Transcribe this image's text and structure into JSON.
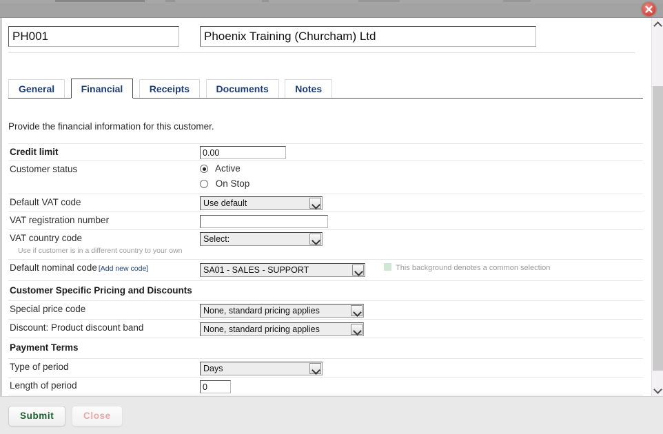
{
  "window": {
    "close_icon": "close-circle-icon"
  },
  "header": {
    "customer_code": "PH001",
    "customer_name": "Phoenix Training (Churcham) Ltd"
  },
  "tabs": [
    {
      "label": "General",
      "active": false
    },
    {
      "label": "Financial",
      "active": true
    },
    {
      "label": "Receipts",
      "active": false
    },
    {
      "label": "Documents",
      "active": false
    },
    {
      "label": "Notes",
      "active": false
    }
  ],
  "intro": "Provide the financial information for this customer.",
  "form": {
    "credit_limit": {
      "label": "Credit limit",
      "value": "0.00"
    },
    "customer_status": {
      "label": "Customer status",
      "options": [
        {
          "label": "Active",
          "checked": true
        },
        {
          "label": "On Stop",
          "checked": false
        }
      ]
    },
    "default_vat_code": {
      "label": "Default VAT code",
      "value": "Use default"
    },
    "vat_registration_number": {
      "label": "VAT registration number",
      "value": ""
    },
    "vat_country_code": {
      "label": "VAT country code",
      "value": "Select:",
      "hint": "Use if customer is in a different country to your own"
    },
    "default_nominal_code": {
      "label": "Default nominal code",
      "add_link": "[Add new code]",
      "value": "SA01 - SALES - SUPPORT"
    },
    "common_selection_legend": "This background denotes a common selection",
    "pricing_section": {
      "title": "Customer Specific Pricing and Discounts",
      "special_price_code": {
        "label": "Special price code",
        "value": "None, standard pricing applies"
      },
      "product_discount_band": {
        "label": "Discount: Product discount band",
        "value": "None, standard pricing applies"
      }
    },
    "payment_section": {
      "title": "Payment Terms",
      "type_of_period": {
        "label": "Type of period",
        "value": "Days"
      },
      "length_of_period": {
        "label": "Length of period",
        "value": "0"
      }
    }
  },
  "footer": {
    "submit_label": "Submit",
    "close_label": "Close"
  },
  "colors": {
    "tab_text": "#1b3c78",
    "submit_text": "#17602e",
    "close_text": "#e9a8a8",
    "common_selection_swatch": "#cfe8d4"
  }
}
